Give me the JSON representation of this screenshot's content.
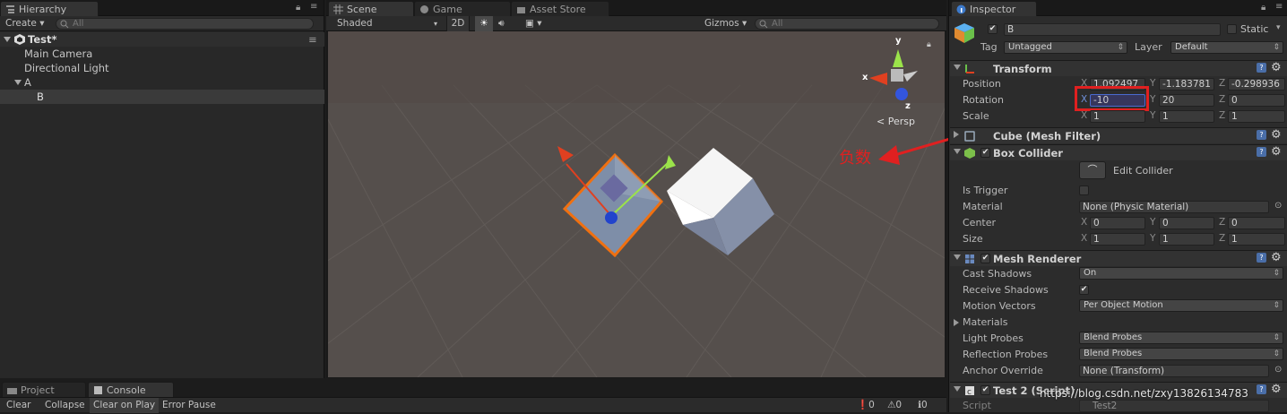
{
  "hierarchy": {
    "tab": "Hierarchy",
    "create_label": "Create",
    "search_placeholder": "All",
    "scene_name": "Test*",
    "items": [
      "Main Camera",
      "Directional Light",
      "A",
      "B"
    ]
  },
  "scene_view": {
    "tabs": [
      "Scene",
      "Game",
      "Asset Store"
    ],
    "shading_mode": "Shaded",
    "mode_2d": "2D",
    "gizmos_label": "Gizmos",
    "search_placeholder": "All",
    "gizmo_axes": {
      "y": "y",
      "x": "x",
      "z": "z"
    },
    "persp_label": "Persp",
    "annotation_text": "负数",
    "annotation_color": "#e02020"
  },
  "inspector": {
    "tab": "Inspector",
    "object_name": "B",
    "static_label": "Static",
    "tag_label": "Tag",
    "tag_value": "Untagged",
    "layer_label": "Layer",
    "layer_value": "Default",
    "transform": {
      "title": "Transform",
      "position_label": "Position",
      "position": {
        "x": "1.092497",
        "y": "-1.183781",
        "z": "-0.298936"
      },
      "rotation_label": "Rotation",
      "rotation": {
        "x": "-10",
        "y": "20",
        "z": "0"
      },
      "scale_label": "Scale",
      "scale": {
        "x": "1",
        "y": "1",
        "z": "1"
      }
    },
    "mesh_filter": {
      "title": "Cube (Mesh Filter)"
    },
    "box_collider": {
      "title": "Box Collider",
      "edit_label": "Edit Collider",
      "is_trigger_label": "Is Trigger",
      "material_label": "Material",
      "material_value": "None (Physic Material)",
      "center_label": "Center",
      "center": {
        "x": "0",
        "y": "0",
        "z": "0"
      },
      "size_label": "Size",
      "size": {
        "x": "1",
        "y": "1",
        "z": "1"
      }
    },
    "mesh_renderer": {
      "title": "Mesh Renderer",
      "cast_shadows_label": "Cast Shadows",
      "cast_shadows_value": "On",
      "receive_shadows_label": "Receive Shadows",
      "motion_vectors_label": "Motion Vectors",
      "motion_vectors_value": "Per Object Motion",
      "materials_label": "Materials",
      "light_probes_label": "Light Probes",
      "light_probes_value": "Blend Probes",
      "reflection_probes_label": "Reflection Probes",
      "reflection_probes_value": "Blend Probes",
      "anchor_override_label": "Anchor Override",
      "anchor_override_value": "None (Transform)"
    },
    "script_component": {
      "title": "Test 2 (Script)",
      "script_label": "Script",
      "script_value": "Test2"
    },
    "axis_labels": {
      "x": "X",
      "y": "Y",
      "z": "Z"
    }
  },
  "bottom": {
    "tabs": [
      "Project",
      "Console"
    ],
    "console_buttons": [
      "Clear",
      "Collapse",
      "Clear on Play",
      "Error Pause"
    ],
    "counts": [
      "0",
      "0",
      "0"
    ]
  },
  "watermark": "https://blog.csdn.net/zxy13826134783"
}
